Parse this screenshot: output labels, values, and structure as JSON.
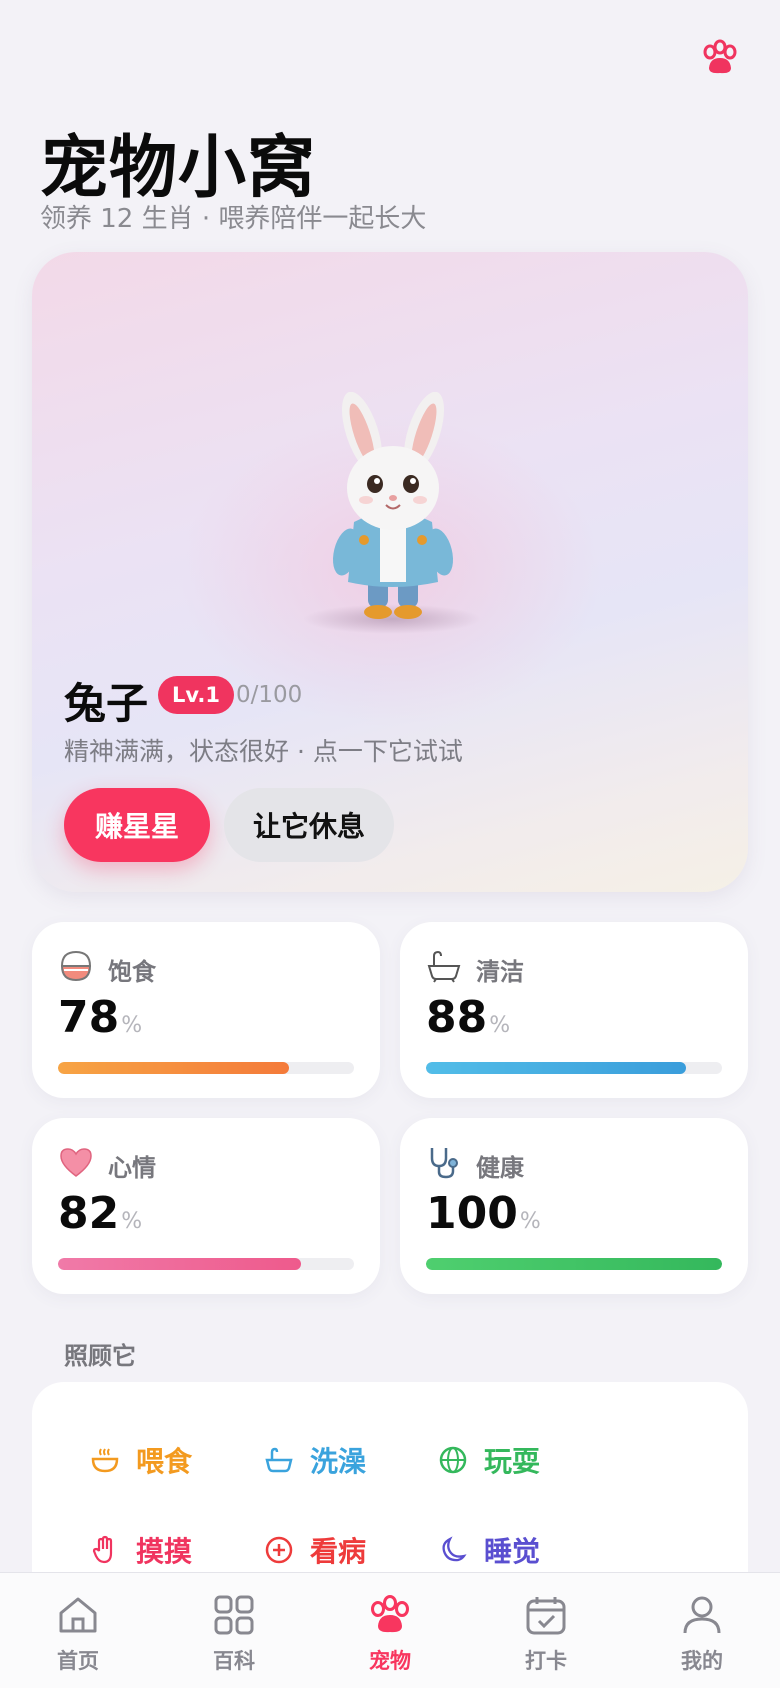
{
  "header": {
    "title": "宠物小窝",
    "subtitle": "领养 12 生肖 · 喂养陪伴一起长大",
    "paw_icon": "paw-icon"
  },
  "pet": {
    "name": "兔子",
    "level": "Lv.1",
    "xp": "0/100",
    "status": "精神满满，状态很好 · 点一下它试试",
    "earn_label": "赚星星",
    "rest_label": "让它休息"
  },
  "stats": [
    {
      "icon": "rice-bowl-icon",
      "label": "饱食",
      "value": "78",
      "unit": "%",
      "level": 0.78,
      "color_start": "#f7a444",
      "color_end": "#f47a3a"
    },
    {
      "icon": "bathtub-icon",
      "label": "清洁",
      "value": "88",
      "unit": "%",
      "level": 0.88,
      "color_start": "#52bde8",
      "color_end": "#3a9ddb"
    },
    {
      "icon": "heart-icon",
      "label": "心情",
      "value": "82",
      "unit": "%",
      "level": 0.82,
      "color_start": "#f07aa8",
      "color_end": "#ee5a8c"
    },
    {
      "icon": "stethoscope-icon",
      "label": "健康",
      "value": "100",
      "unit": "%",
      "level": 1.0,
      "color_start": "#4fcf6f",
      "color_end": "#34b85c"
    }
  ],
  "care": {
    "title": "照顾它",
    "actions": [
      {
        "icon": "bowl-icon",
        "label": "喂食",
        "color": "#f39a1f"
      },
      {
        "icon": "bath-icon",
        "label": "洗澡",
        "color": "#3aa3dd"
      },
      {
        "icon": "globe-icon",
        "label": "玩耍",
        "color": "#34b85c"
      },
      {
        "icon": "hand-icon",
        "label": "摸摸",
        "color": "#f0345f"
      },
      {
        "icon": "plus-circle-icon",
        "label": "看病",
        "color": "#ee3b3b"
      },
      {
        "icon": "moon-icon",
        "label": "睡觉",
        "color": "#5a4fd0"
      }
    ]
  },
  "tabbar": {
    "items": [
      {
        "icon": "home-icon",
        "label": "首页"
      },
      {
        "icon": "grid-icon",
        "label": "百科"
      },
      {
        "icon": "paw-icon",
        "label": "宠物",
        "active": true
      },
      {
        "icon": "calendar-check-icon",
        "label": "打卡"
      },
      {
        "icon": "user-icon",
        "label": "我的"
      }
    ]
  },
  "colors": {
    "accent": "#f8365f",
    "background": "#f3f2f7"
  }
}
